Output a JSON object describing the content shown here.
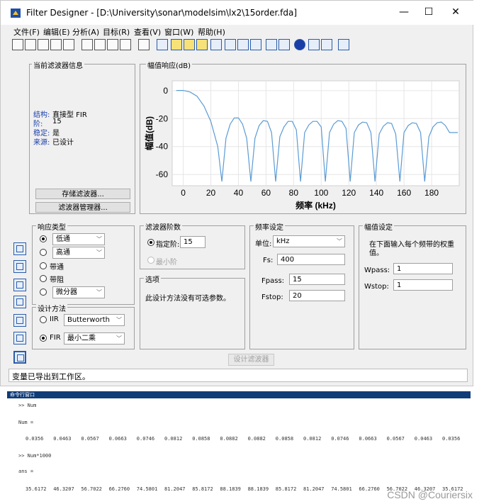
{
  "window": {
    "title": "Filter Designer - [D:\\University\\sonar\\modelsim\\lx2\\15order.fda]",
    "minimize": "—",
    "maximize": "☐",
    "close": "✕"
  },
  "menu": [
    "文件(F)",
    "编辑(E)",
    "分析(A)",
    "目标(R)",
    "查看(V)",
    "窗口(W)",
    "帮助(H)"
  ],
  "toolbar_icons": [
    "new-icon",
    "open-icon",
    "save-icon",
    "print-icon",
    "print-preview-icon",
    "zoom-in-icon",
    "zoom-x-icon",
    "zoom-y-icon",
    "full-view-icon",
    "new-window-icon",
    "filter-specs-icon",
    "magnitude-response-icon",
    "phase-response-icon",
    "magnitude-phase-icon",
    "group-delay-icon",
    "phase-delay-icon",
    "impulse-response-icon",
    "step-response-icon",
    "pole-zero-icon",
    "coefficients-icon",
    "filter-info-icon",
    "magnitude-estimate-icon",
    "noise-icon",
    "whats-this-icon"
  ],
  "current_filter": {
    "legend": "当前滤波器信息",
    "structure_label": "结构:",
    "structure_value": "直接型 FIR",
    "order_label": "阶:",
    "order_value": "15",
    "stable_label": "稳定:",
    "stable_value": "是",
    "source_label": "来源:",
    "source_value": "已设计",
    "store_button": "存储滤波器...",
    "manager_button": "滤波器管理器..."
  },
  "magnitude_panel": {
    "legend": "幅值响应(dB)"
  },
  "chart_data": {
    "type": "line",
    "xlabel": "频率 (kHz)",
    "ylabel": "幅值(dB)",
    "xlim": [
      -8,
      200
    ],
    "ylim": [
      -68,
      7
    ],
    "xticks": [
      0,
      20,
      40,
      60,
      80,
      100,
      120,
      140,
      160,
      180
    ],
    "yticks": [
      0,
      -20,
      -40,
      -60
    ],
    "grid": true,
    "series": [
      {
        "color": "#5b9bd5",
        "x": [
          -5,
          0,
          5,
          10,
          15,
          20,
          25,
          28,
          31,
          34,
          37,
          40,
          43,
          46,
          49,
          52,
          55,
          58,
          61,
          64,
          67,
          70,
          73,
          76,
          79,
          82,
          85,
          88,
          91,
          94,
          97,
          100,
          103,
          106,
          109,
          112,
          115,
          118,
          121,
          124,
          127,
          130,
          133,
          136,
          139,
          142,
          145,
          148,
          151,
          154,
          157,
          160,
          163,
          166,
          169,
          172,
          175,
          178,
          181,
          184,
          187,
          190,
          193,
          196,
          199
        ],
        "y": [
          0.1,
          0.1,
          -1,
          -4,
          -11,
          -22,
          -40,
          -65,
          -34,
          -24,
          -19.5,
          -19.5,
          -24,
          -34,
          -65,
          -34,
          -25,
          -21.5,
          -22,
          -30,
          -65,
          -33,
          -26,
          -22,
          -22,
          -28,
          -65,
          -30,
          -24.5,
          -22,
          -22,
          -26,
          -65,
          -30,
          -24,
          -21.5,
          -22,
          -27,
          -65,
          -30,
          -24.5,
          -22.5,
          -23,
          -30,
          -65,
          -31,
          -25.5,
          -23,
          -23.5,
          -31,
          -65,
          -30,
          -25,
          -23,
          -23.5,
          -30,
          -65,
          -33,
          -26,
          -23,
          -22.5,
          -25,
          -30,
          -30,
          -30
        ]
      }
    ]
  },
  "response_type": {
    "legend": "响应类型",
    "lowpass": "低通",
    "highpass": "高通",
    "bandpass": "带通",
    "bandstop": "带阻",
    "differentiator": "微分器"
  },
  "design_method": {
    "legend": "设计方法",
    "iir_label": "IIR",
    "iir_value": "Butterworth",
    "fir_label": "FIR",
    "fir_value": "最小二乘"
  },
  "filter_order": {
    "legend": "滤波器阶数",
    "specify_label": "指定阶:",
    "specify_value": "15",
    "minimum_label": "最小阶"
  },
  "options": {
    "legend": "选项",
    "text": "此设计方法没有可选参数。"
  },
  "freq_spec": {
    "legend": "频率设定",
    "unit_label": "单位:",
    "unit_value": "kHz",
    "fs_label": "Fs:",
    "fs_value": "400",
    "fpass_label": "Fpass:",
    "fpass_value": "15",
    "fstop_label": "Fstop:",
    "fstop_value": "20"
  },
  "mag_spec": {
    "legend": "幅值设定",
    "hint": "在下面输入每个频带的权重值。",
    "wpass_label": "Wpass:",
    "wpass_value": "1",
    "wstop_label": "Wstop:",
    "wstop_value": "1"
  },
  "design_button": "设计滤波器",
  "status": "变量已导出到工作区。",
  "command_window": {
    "title": "命令行窗口",
    "line1": ">> Num",
    "line2": "Num =",
    "num_values": [
      "0.0356",
      "0.0463",
      "0.0567",
      "0.0663",
      "0.0746",
      "0.0812",
      "0.0858",
      "0.0882",
      "0.0882",
      "0.0858",
      "0.0812",
      "0.0746",
      "0.0663",
      "0.0567",
      "0.0463",
      "0.0356"
    ],
    "line3": ">> Num*1000",
    "line4": "ans =",
    "ans_values": [
      "35.6172",
      "46.3207",
      "56.7022",
      "66.2760",
      "74.5801",
      "81.2047",
      "85.8172",
      "88.1839",
      "88.1839",
      "85.8172",
      "81.2047",
      "74.5801",
      "66.2760",
      "56.7022",
      "46.3207",
      "35.6172"
    ]
  },
  "watermark": "CSDN @Couriersix"
}
